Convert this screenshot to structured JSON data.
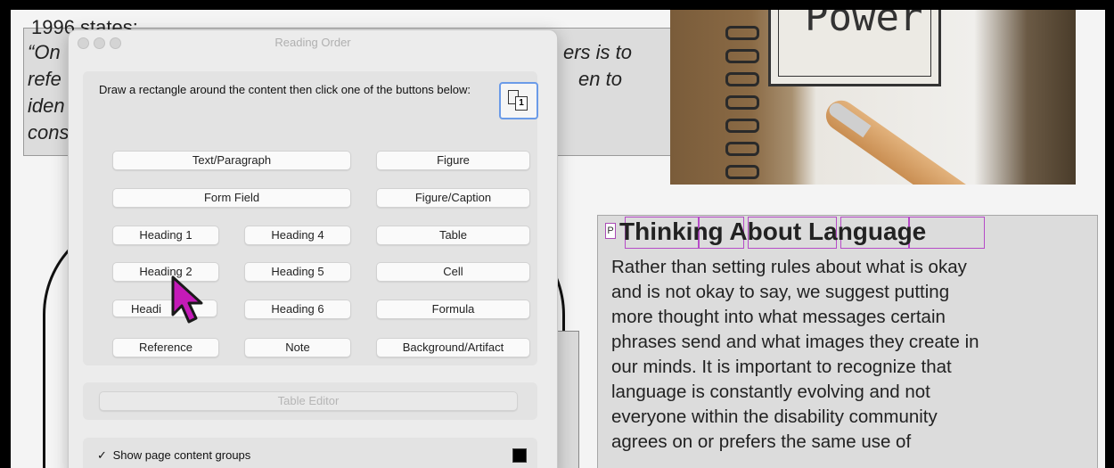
{
  "document": {
    "heading_fragment": "1996 states:",
    "quote_lines": [
      "“On",
      "refe",
      "iden",
      "cons"
    ],
    "quote_right_lines": [
      "ers is to",
      "en to"
    ],
    "photo_word": "Power",
    "section_heading": "Thinking About Language",
    "section_tag": "P",
    "body_lines": [
      "Rather than setting rules about what is okay",
      "and is not okay to say, we suggest putting",
      "more thought into what messages certain",
      "phrases send and what images they create in",
      "our minds. It is important to recognize that",
      "language is constantly evolving and not",
      "everyone within the disability community",
      "agrees on or prefers the same use of"
    ]
  },
  "dialog": {
    "title": "Reading Order",
    "instruction": "Draw a rectangle around the content then click one of the buttons below:",
    "icon_badge": "1",
    "buttons": {
      "text_paragraph": "Text/Paragraph",
      "figure": "Figure",
      "form_field": "Form Field",
      "figure_caption": "Figure/Caption",
      "heading1": "Heading 1",
      "heading4": "Heading 4",
      "table": "Table",
      "heading2": "Heading 2",
      "heading5": "Heading 5",
      "cell": "Cell",
      "heading3": "Headi",
      "heading6": "Heading 6",
      "formula": "Formula",
      "reference": "Reference",
      "note": "Note",
      "background_artifact": "Background/Artifact",
      "table_editor": "Table Editor"
    },
    "show_groups_label": "Show page content groups",
    "show_groups_checked": "✓",
    "swatch_color": "#000000"
  },
  "colors": {
    "highlight": "#b64bc7",
    "focus_ring": "#6b9be8",
    "cursor": "#c41ab8"
  }
}
